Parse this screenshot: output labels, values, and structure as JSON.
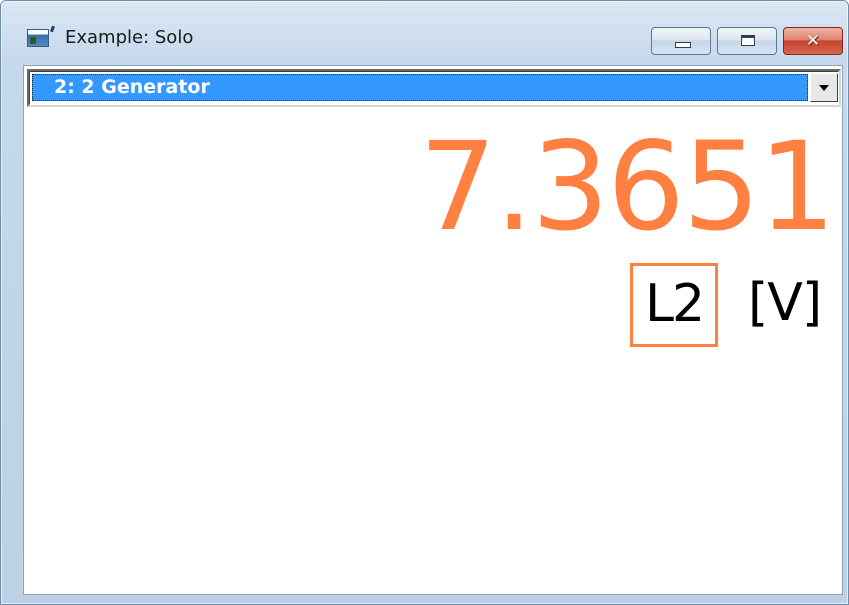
{
  "window": {
    "title": "Example: Solo"
  },
  "title_bar": {
    "minimize_icon": "minimize-icon",
    "maximize_icon": "maximize-icon",
    "close_icon": "close-icon",
    "close_glyph": "✕"
  },
  "selector": {
    "selected_value": "2: 2 Generator",
    "arrow_icon": "chevron-down-icon"
  },
  "measurement": {
    "value": "7.3651",
    "channel": "L2",
    "unit": "[V]"
  },
  "colors": {
    "value_color": "#ff8040",
    "channel_box_border": "#ff8040",
    "selection_highlight": "#3399ff",
    "close_button": "#c8452e"
  }
}
